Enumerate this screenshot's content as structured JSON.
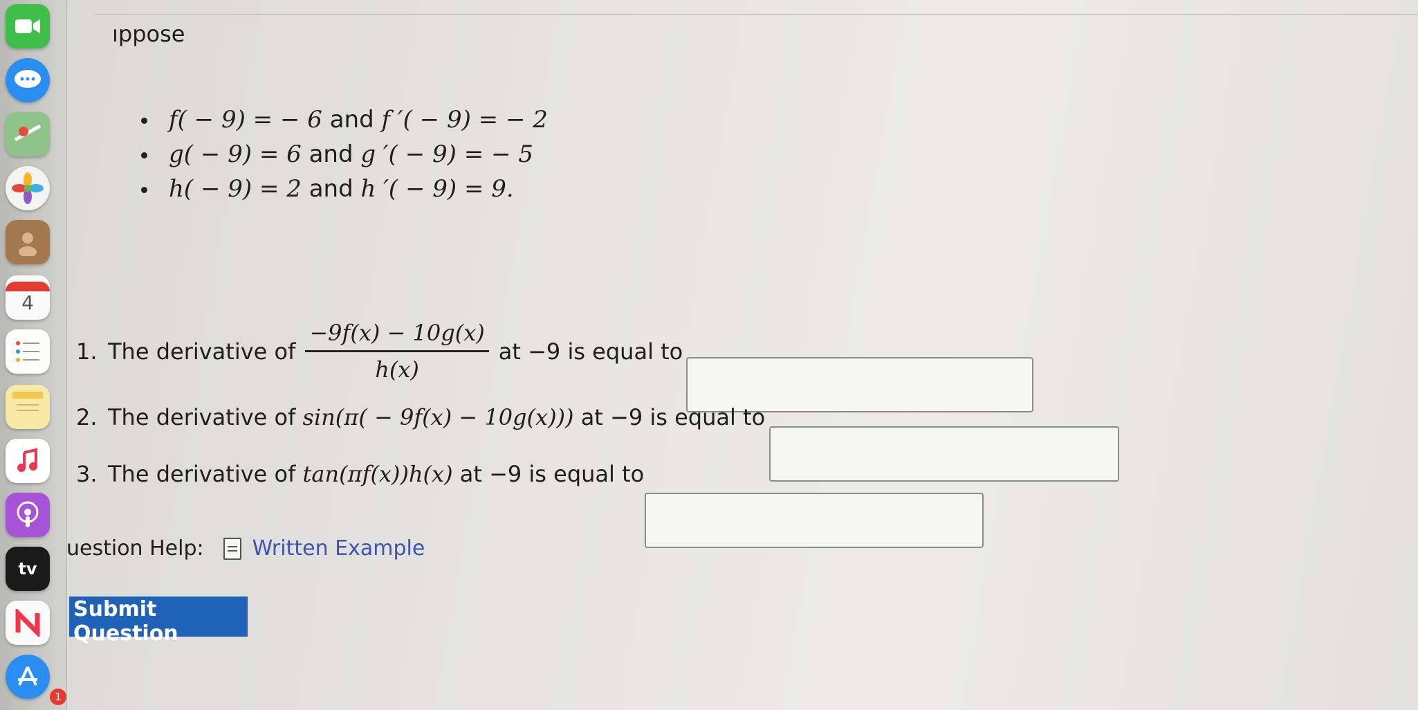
{
  "page": {
    "heading": "ıppose",
    "facts": [
      {
        "f": "f( − 9) = − 6",
        "j": " and ",
        "d": "f ′( − 9) = − 2"
      },
      {
        "f": "g( − 9) = 6",
        "j": " and ",
        "d": "g ′( − 9) = − 5"
      },
      {
        "f": "h( − 9) = 2",
        "j": " and ",
        "d": "h ′( − 9) = 9."
      }
    ],
    "questions": [
      {
        "num": "1.",
        "prefix": "The derivative of",
        "numerator": "−9f(x) − 10g(x)",
        "denominator": "h(x)",
        "suffix": "at −9 is equal to"
      },
      {
        "num": "2.",
        "prefix": "The derivative of",
        "expr": "sin(π( − 9f(x) − 10g(x)))",
        "suffix": "at −9 is equal to"
      },
      {
        "num": "3.",
        "prefix": "The derivative of",
        "expr": "tan(πf(x))h(x)",
        "suffix": "at −9 is equal to"
      }
    ],
    "help": {
      "label": "uestion Help:",
      "link": "Written Example"
    },
    "submit": "Submit Question"
  },
  "dock": {
    "calendar_day": "4",
    "tv_label": "tv",
    "badge": "1"
  },
  "colors": {
    "submit_bg": "#1f63b8",
    "link": "#3a55b5"
  }
}
